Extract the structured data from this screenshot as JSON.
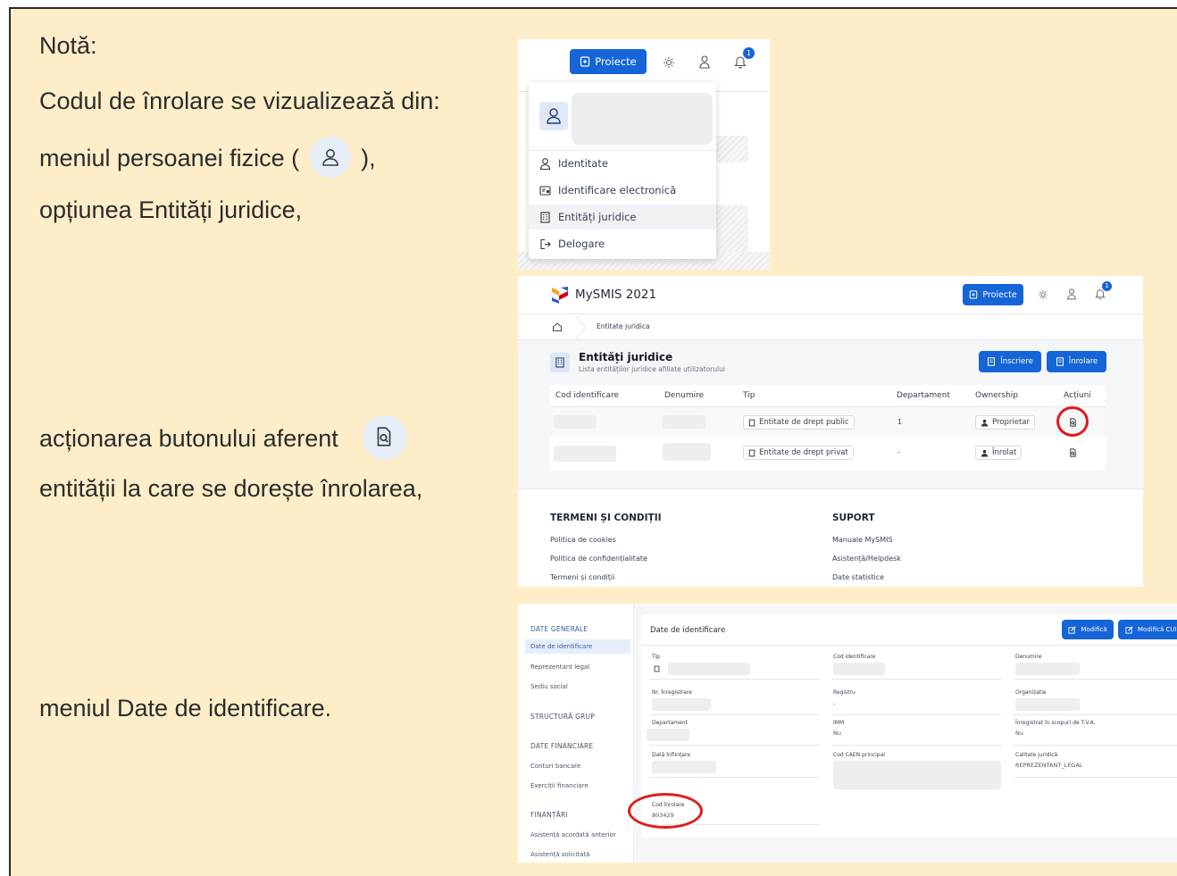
{
  "notes": {
    "heading": "Notă:",
    "line1": "Codul de înrolare se vizualizează din:",
    "line2_prefix": "meniul persoanei fizice (",
    "line2_suffix": "),",
    "line3": "opțiunea Entități juridice,",
    "line4": "acționarea  butonului aferent",
    "line5": "entității la care se dorește înrolarea,",
    "line6": "meniul Date de identificare."
  },
  "shot1": {
    "projects_button": "Proiecte",
    "notification_count": "1",
    "menu": [
      "Identitate",
      "Identificare electronică",
      "Entități juridice",
      "Delogare"
    ]
  },
  "shot2": {
    "app_title": "MySMIS 2021",
    "projects_button": "Proiecte",
    "notification_count": "1",
    "breadcrumb": "Entitate juridica",
    "page_title": "Entități juridice",
    "page_subtitle": "Lista entităților juridice afiliate utilizatorului",
    "btn_register": "Înscriere",
    "btn_enroll": "Înrolare",
    "columns": [
      "Cod identificare",
      "Denumire",
      "Tip",
      "Departament",
      "Ownership",
      "Acțiuni"
    ],
    "rows": [
      {
        "tip": "Entitate de drept public",
        "departament": "1",
        "ownership": "Proprietar"
      },
      {
        "tip": "Entitate de drept privat",
        "departament": "-",
        "ownership": "Înrolat"
      }
    ],
    "footer": {
      "terms_title": "TERMENI ȘI CONDIȚII",
      "terms_links": [
        "Politica de cookies",
        "Politica de confidențialitate",
        "Termeni și condiții"
      ],
      "support_title": "SUPORT",
      "support_links": [
        "Manuale MySMIS",
        "Asistență/Helpdesk",
        "Date statistice"
      ]
    }
  },
  "shot3": {
    "sidebar": {
      "general_head": "DATE GENERALE",
      "general_items": [
        "Date de identificare",
        "Reprezentant legal",
        "Sediu social"
      ],
      "group_head": "STRUCTURĂ GRUP",
      "financial_head": "DATE FINANCIARE",
      "financial_items": [
        "Conturi bancare",
        "Exerciții financiare"
      ],
      "funding_head": "FINANȚĂRI",
      "funding_items": [
        "Asistență acordată anterior",
        "Asistență solicitată"
      ]
    },
    "panel_title": "Date de identificare",
    "btn_modify": "Modifică",
    "btn_modify_cui": "Modifică CUI",
    "fields": {
      "tip": "Tip",
      "cod_identificare": "Cod identificare",
      "denumire": "Denumire",
      "nr_inregistrare": "Nr. înregistrare",
      "registru": "Registru",
      "registru_val": "-",
      "organizatie": "Organizatie",
      "departament": "Departament",
      "imm": "IMM",
      "imm_val": "Nu",
      "tva": "Înregistrat în scopuri de T.V.A.",
      "tva_val": "Nu",
      "data_infiintare": "Dată înființare",
      "caen": "Cod CAEN principal",
      "calitate": "Calitate juridică",
      "calitate_val": "REPREZENTANT_LEGAL",
      "cod_inrolare": "Cod înrolare",
      "cod_inrolare_val": "803429"
    }
  },
  "colors": {
    "slide_bg": "#fdeec9",
    "accent_blue": "#1565d8",
    "highlight_red": "#e01b1b",
    "notification_blue": "#1565d8"
  }
}
